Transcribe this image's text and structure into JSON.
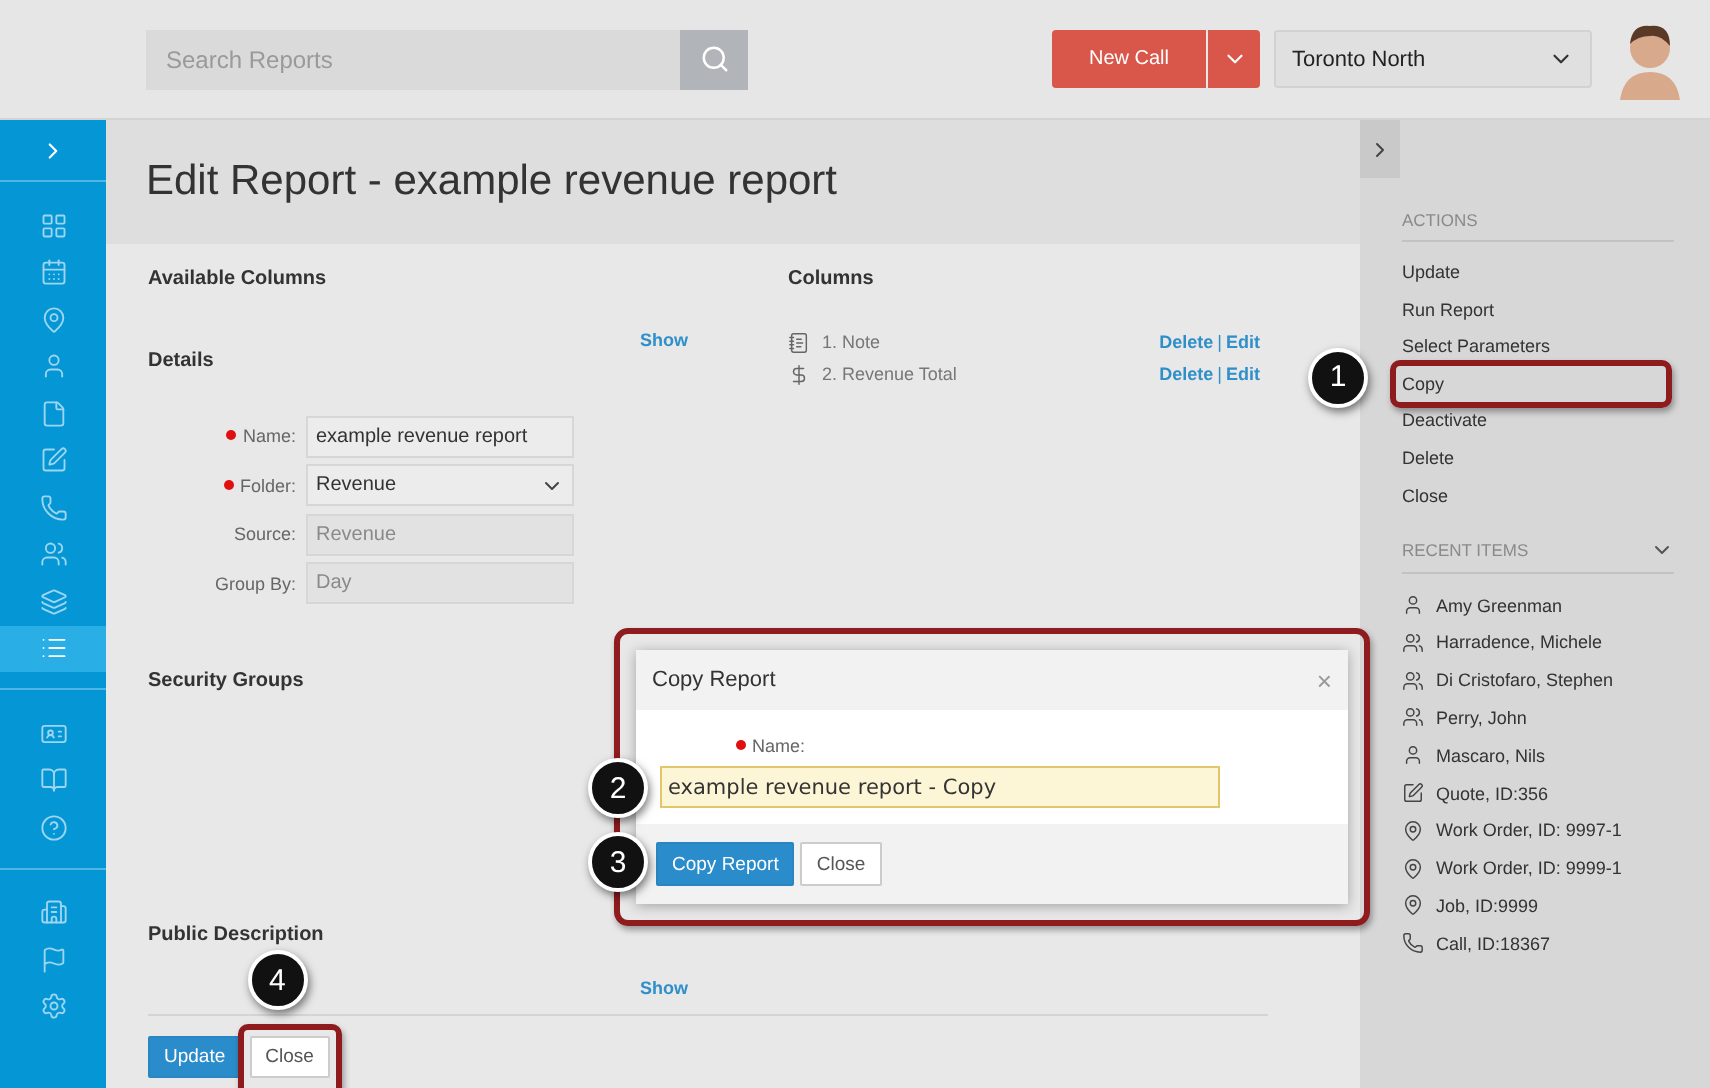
{
  "topbar": {
    "search": {
      "placeholder": "Search Reports"
    },
    "new_call": "New Call",
    "location": "Toronto North"
  },
  "sidebar": {
    "groups": [
      [
        {
          "kind": "grid",
          "selected": false
        },
        {
          "kind": "calendar",
          "selected": false
        },
        {
          "kind": "pin",
          "selected": false
        },
        {
          "kind": "user",
          "selected": false
        },
        {
          "kind": "file",
          "selected": false
        },
        {
          "kind": "edit",
          "selected": false
        },
        {
          "kind": "phone",
          "selected": false
        },
        {
          "kind": "users",
          "selected": false
        },
        {
          "kind": "layers",
          "selected": false
        },
        {
          "kind": "list",
          "selected": true
        }
      ],
      [
        {
          "kind": "card",
          "selected": false
        },
        {
          "kind": "book",
          "selected": false
        },
        {
          "kind": "help",
          "selected": false
        }
      ],
      [
        {
          "kind": "building",
          "selected": false
        },
        {
          "kind": "flag",
          "selected": false
        },
        {
          "kind": "gear",
          "selected": false
        }
      ]
    ]
  },
  "page_title": "Edit Report - example revenue report",
  "available_columns": {
    "heading": "Available Columns",
    "toggle": "Show"
  },
  "columns": {
    "heading": "Columns",
    "items": [
      {
        "kind": "note",
        "label": "1. Note",
        "delete": "Delete",
        "separator": "|",
        "edit": "Edit"
      },
      {
        "kind": "dollar",
        "label": "2. Revenue Total",
        "delete": "Delete",
        "separator": "|",
        "edit": "Edit"
      }
    ]
  },
  "details": {
    "heading": "Details",
    "fields": [
      {
        "label": "Name:",
        "required": true,
        "kind": "input",
        "value": "example revenue report",
        "disabled": false
      },
      {
        "label": "Folder:",
        "required": true,
        "kind": "select",
        "value": "Revenue",
        "disabled": false
      },
      {
        "label": "Source:",
        "required": false,
        "kind": "input",
        "value": "Revenue",
        "disabled": true
      },
      {
        "label": "Group By:",
        "required": false,
        "kind": "input",
        "value": "Day",
        "disabled": true
      }
    ]
  },
  "security_groups": {
    "heading": "Security Groups"
  },
  "public_description": {
    "heading": "Public Description",
    "toggle": "Show"
  },
  "footer_buttons": [
    {
      "label": "Update",
      "kind": "primary",
      "highlighted": false
    },
    {
      "label": "Close",
      "kind": "secondary",
      "highlighted": true,
      "callout": "4"
    }
  ],
  "dialog": {
    "title": "Copy Report",
    "close": "×",
    "field_label": "Name:",
    "required": true,
    "value": "example revenue report - Copy",
    "field_callout": "2",
    "buttons_callout": "3",
    "highlighted": true,
    "buttons": [
      {
        "label": "Copy Report",
        "kind": "primary"
      },
      {
        "label": "Close",
        "kind": "secondary"
      }
    ]
  },
  "actions": {
    "heading": "ACTIONS",
    "items": [
      {
        "label": "Update",
        "highlighted": false
      },
      {
        "label": "Run Report",
        "highlighted": false
      },
      {
        "label": "Select Parameters",
        "highlighted": false
      },
      {
        "label": "Copy",
        "highlighted": true,
        "callout": "1"
      },
      {
        "label": "Deactivate",
        "highlighted": false
      },
      {
        "label": "Delete",
        "highlighted": false
      },
      {
        "label": "Close",
        "highlighted": false
      }
    ]
  },
  "recent_items": {
    "heading": "RECENT ITEMS",
    "items": [
      {
        "kind": "user",
        "label": "Amy Greenman"
      },
      {
        "kind": "users",
        "label": "Harradence, Michele"
      },
      {
        "kind": "users",
        "label": "Di Cristofaro, Stephen"
      },
      {
        "kind": "users",
        "label": "Perry, John"
      },
      {
        "kind": "user",
        "label": "Mascaro, Nils"
      },
      {
        "kind": "edit",
        "label": "Quote, ID:356"
      },
      {
        "kind": "pin",
        "label": "Work Order, ID: 9997-1"
      },
      {
        "kind": "pin",
        "label": "Work Order, ID: 9999-1"
      },
      {
        "kind": "pin",
        "label": "Job, ID:9999"
      },
      {
        "kind": "phone",
        "label": "Call, ID:18367"
      }
    ]
  }
}
